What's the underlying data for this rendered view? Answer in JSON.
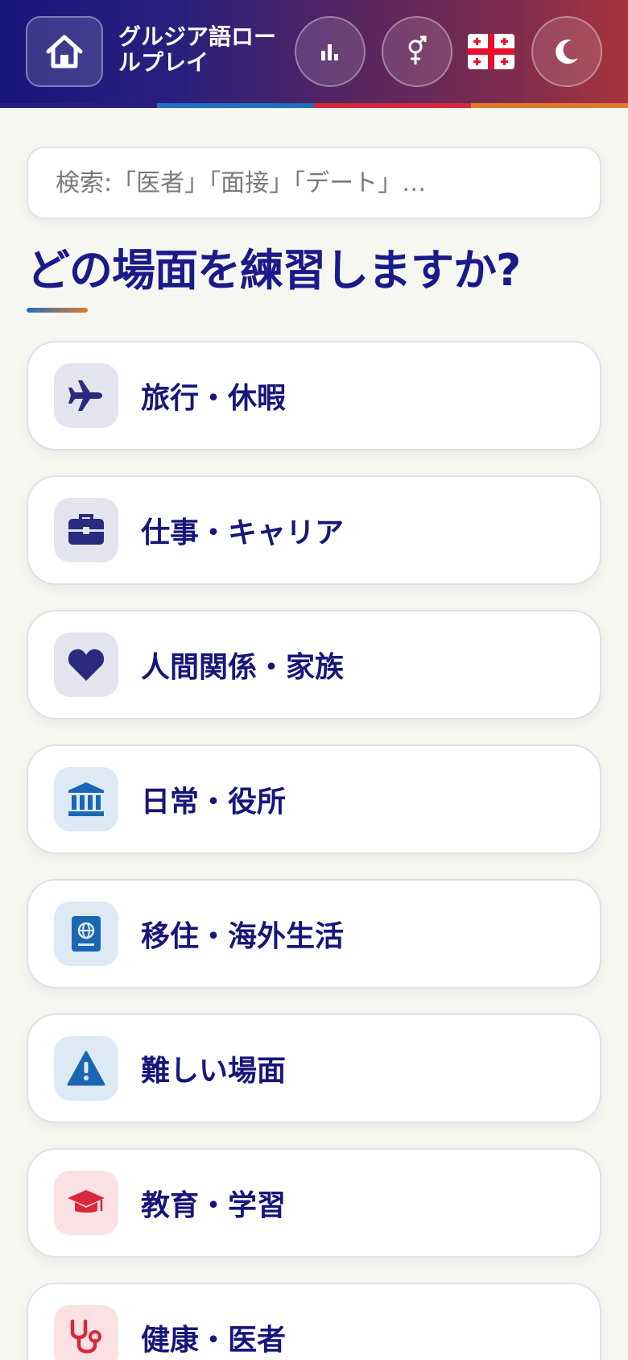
{
  "header": {
    "title": "グルジア語ロールプレイ",
    "home_icon": "home-icon",
    "buttons": [
      {
        "icon": "stats-icon"
      },
      {
        "icon": "gender-icon"
      },
      {
        "icon": "georgia-flag-icon"
      },
      {
        "icon": "moon-icon"
      }
    ],
    "stripe_colors": [
      "#2a1f7e",
      "#1f6fc0",
      "#d8283c",
      "#e07a2a"
    ]
  },
  "search": {
    "placeholder": "検索:「医者」「面接」「デート」…",
    "value": ""
  },
  "main": {
    "heading": "どの場面を練習しますか?",
    "categories": [
      {
        "label": "旅行・休暇",
        "icon": "airplane-icon",
        "icon_color": "#2a2a7e",
        "icon_bg": "#e4e4ef"
      },
      {
        "label": "仕事・キャリア",
        "icon": "briefcase-icon",
        "icon_color": "#2a2a7e",
        "icon_bg": "#e4e4ef"
      },
      {
        "label": "人間関係・家族",
        "icon": "heart-icon",
        "icon_color": "#2a2a7e",
        "icon_bg": "#e4e4ef"
      },
      {
        "label": "日常・役所",
        "icon": "bank-icon",
        "icon_color": "#1a66b4",
        "icon_bg": "#ddeaf5"
      },
      {
        "label": "移住・海外生活",
        "icon": "passport-icon",
        "icon_color": "#1a66b4",
        "icon_bg": "#ddeaf5"
      },
      {
        "label": "難しい場面",
        "icon": "warning-icon",
        "icon_color": "#1a66b4",
        "icon_bg": "#ddeaf5"
      },
      {
        "label": "教育・学習",
        "icon": "graduation-cap-icon",
        "icon_color": "#d8283c",
        "icon_bg": "#fbe1e4"
      },
      {
        "label": "健康・医者",
        "icon": "stethoscope-icon",
        "icon_color": "#d8283c",
        "icon_bg": "#fbe1e4"
      }
    ]
  }
}
